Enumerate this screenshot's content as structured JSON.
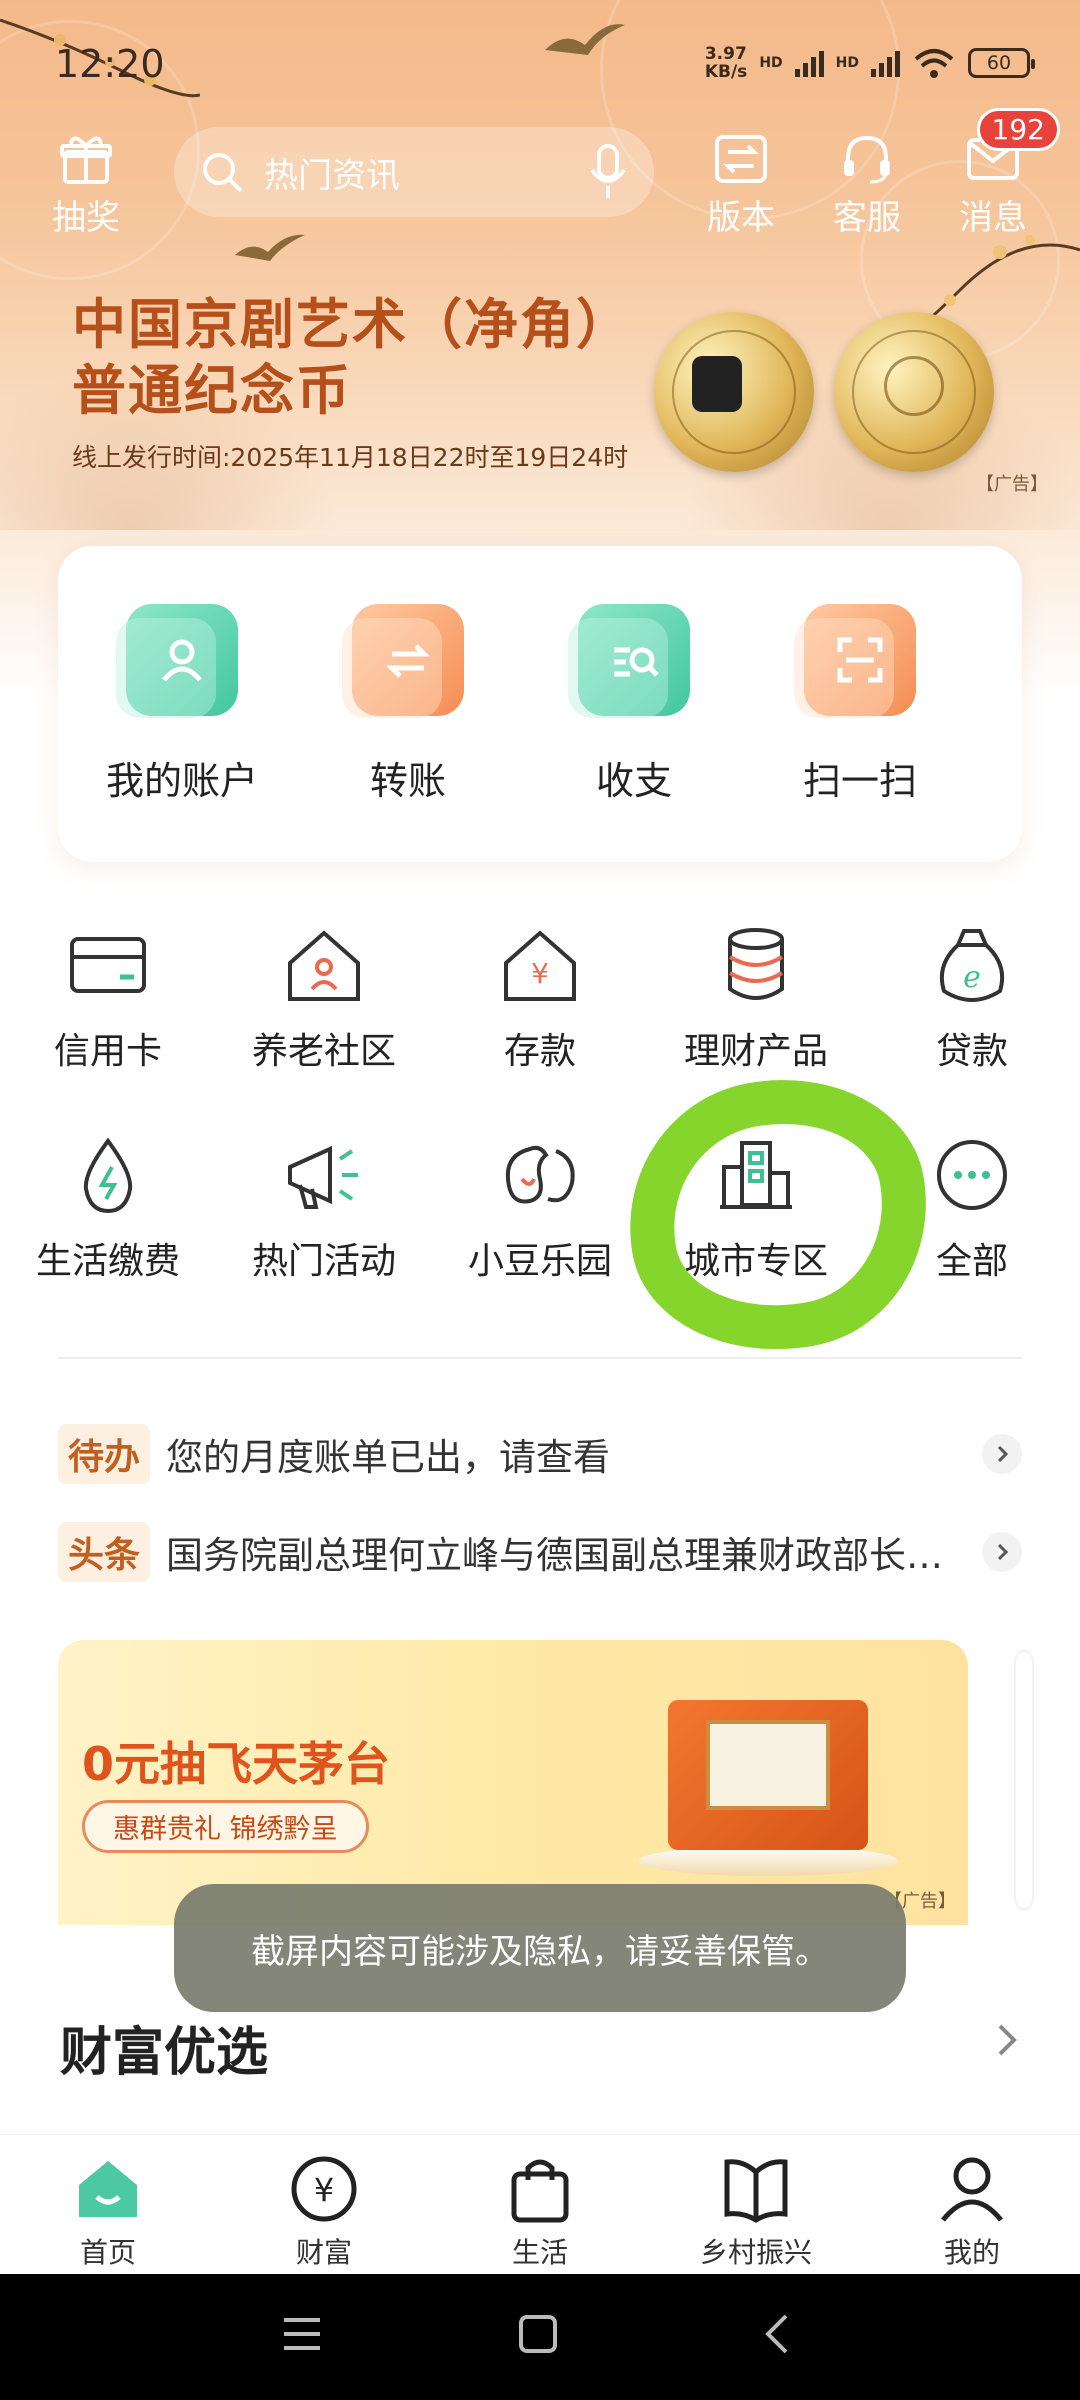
{
  "status_bar": {
    "time": "12:20",
    "net_speed_value": "3.97",
    "net_speed_unit": "KB/s",
    "hd_label": "HD",
    "battery": "60"
  },
  "top_bar": {
    "lottery_label": "抽奖",
    "search_placeholder": "热门资讯",
    "version_label": "版本",
    "service_label": "客服",
    "messages_label": "消息",
    "messages_badge": "192"
  },
  "promo": {
    "title_line1": "中国京剧艺术（净角）",
    "title_line2": "普通纪念币",
    "subtitle": "线上发行时间:2025年11月18日22时至19日24时",
    "ad_tag": "【广告】"
  },
  "quick_actions": [
    {
      "label": "我的账户",
      "icon": "account-icon",
      "color": "green"
    },
    {
      "label": "转账",
      "icon": "transfer-icon",
      "color": "orange"
    },
    {
      "label": "收支",
      "icon": "income-expense-icon",
      "color": "green"
    },
    {
      "label": "扫一扫",
      "icon": "scan-icon",
      "color": "orange"
    }
  ],
  "services": [
    {
      "label": "信用卡",
      "icon": "credit-card-icon"
    },
    {
      "label": "养老社区",
      "icon": "pension-community-icon"
    },
    {
      "label": "存款",
      "icon": "deposit-icon"
    },
    {
      "label": "理财产品",
      "icon": "wealth-product-icon"
    },
    {
      "label": "贷款",
      "icon": "loan-icon"
    },
    {
      "label": "生活缴费",
      "icon": "utility-payment-icon"
    },
    {
      "label": "热门活动",
      "icon": "hot-activity-icon"
    },
    {
      "label": "小豆乐园",
      "icon": "bean-park-icon"
    },
    {
      "label": "城市专区",
      "icon": "city-zone-icon"
    },
    {
      "label": "全部",
      "icon": "more-icon"
    }
  ],
  "news": [
    {
      "tag": "待办",
      "text": "您的月度账单已出，请查看"
    },
    {
      "tag": "头条",
      "text": "国务院副总理何立峰与德国副总理兼财政部长克林拜尔举行会谈"
    }
  ],
  "banner": {
    "title": "0元抽飞天茅台",
    "subtitle": "惠群贵礼 锦绣黔呈",
    "ad_tag": "【广告】"
  },
  "toast": "截屏内容可能涉及隐私，请妥善保管。",
  "section": {
    "title": "财富优选"
  },
  "bottom_nav": [
    {
      "label": "首页",
      "icon": "home-icon",
      "active": true
    },
    {
      "label": "财富",
      "icon": "wealth-icon",
      "active": false
    },
    {
      "label": "生活",
      "icon": "life-bag-icon",
      "active": false
    },
    {
      "label": "乡村振兴",
      "icon": "rural-book-icon",
      "active": false
    },
    {
      "label": "我的",
      "icon": "profile-icon",
      "active": false
    }
  ],
  "colors": {
    "accent_green": "#42c79c",
    "accent_orange": "#f58d52",
    "promo_title": "#b5501a",
    "annotation": "#7ed321",
    "badge": "#e8433b"
  }
}
